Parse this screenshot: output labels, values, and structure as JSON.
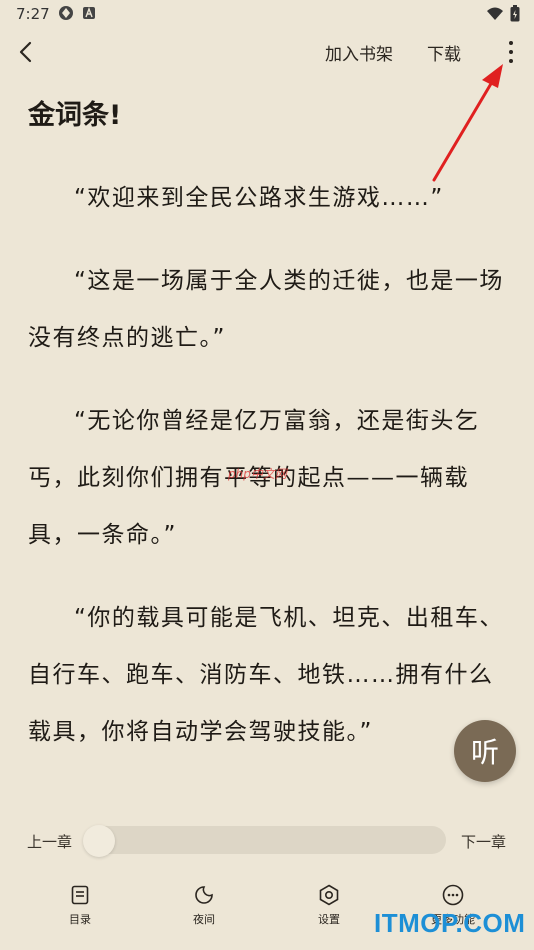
{
  "status_bar": {
    "time": "7:27"
  },
  "top_bar": {
    "add_to_shelf": "加入书架",
    "download": "下载"
  },
  "reader": {
    "chapter_title": "金词条!",
    "paragraphs": [
      "“欢迎来到全民公路求生游戏……”",
      "“这是一场属于全人类的迁徙，也是一场没有终点的逃亡。”",
      "“无论你曾经是亿万富翁，还是街头乞丐，此刻你们拥有平等的起点——一辆载具，一条命。”",
      "“你的载具可能是飞机、坦克、出租车、自行车、跑车、消防车、地铁……拥有什么载具，你将自动学会驾驶技能。”"
    ]
  },
  "listen_button": "听",
  "progress": {
    "prev_label": "上一章",
    "next_label": "下一章",
    "value": 0
  },
  "bottom_nav": {
    "items": [
      {
        "label": "目录",
        "icon": "catalog-icon"
      },
      {
        "label": "夜间",
        "icon": "moon-icon"
      },
      {
        "label": "设置",
        "icon": "settings-icon"
      },
      {
        "label": "更多功能",
        "icon": "more-functions-icon"
      }
    ]
  },
  "watermarks": {
    "php": "php中文网",
    "site": "ITMOP.COM"
  },
  "colors": {
    "background": "#ede6d6",
    "listen_button": "#7a6a55",
    "annotation_arrow": "#e02020",
    "site_watermark": "#1d8fd6"
  }
}
